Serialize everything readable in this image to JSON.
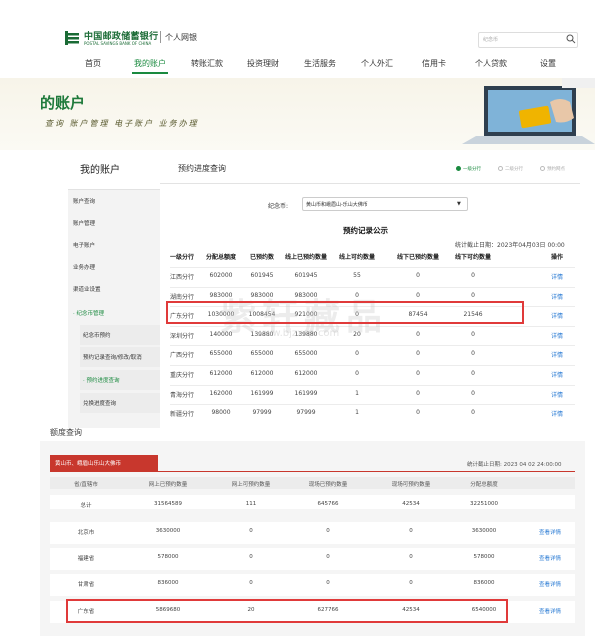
{
  "header": {
    "bank_name": "中国邮政储蓄银行",
    "bank_name_en": "POSTAL SAVINGS BANK OF CHINA",
    "site_label": "个人网银",
    "search_placeholder": "纪念币"
  },
  "nav": {
    "items": [
      "首页",
      "我的账户",
      "转账汇款",
      "投资理财",
      "生活服务",
      "个人外汇",
      "信用卡",
      "个人贷款",
      "设置"
    ],
    "active_index": 1
  },
  "banner": {
    "title": "的账户",
    "subtitle": "查询 账户管理 电子账户 业务办理"
  },
  "sidebar": {
    "title": "我的账户",
    "items": [
      "账户查询",
      "账户管理",
      "电子账户",
      "业务办理",
      "渠道业设置"
    ],
    "active_group": "· 纪念币管理",
    "sub_items": [
      "纪念币预约",
      "预约记录查询/修改/取消",
      "· 预约进度查询",
      "兑换进度查询"
    ]
  },
  "main": {
    "title": "预约进度查询",
    "steps": [
      "一级分行",
      "二级分行",
      "预约网点"
    ],
    "select_label": "纪念币:",
    "select_value": "黄山币和峨眉山-乐山大佛币",
    "publication_title": "预约记录公示",
    "stats_date": "统计截止日期：2023年04月03日 00:00",
    "table": {
      "headers": [
        "一级分行",
        "分配总额度",
        "已预约数",
        "线上已预约数量",
        "线上可约数量",
        "线下已预约数量",
        "线下可约数量",
        "操作"
      ],
      "rows": [
        [
          "江西分行",
          "602000",
          "601945",
          "601945",
          "55",
          "0",
          "0",
          "详情"
        ],
        [
          "湖南分行",
          "983000",
          "983000",
          "983000",
          "0",
          "0",
          "0",
          "详情"
        ],
        [
          "广东分行",
          "1030000",
          "1008454",
          "921000",
          "0",
          "87454",
          "21546",
          "详情"
        ],
        [
          "深圳分行",
          "140000",
          "139880",
          "139880",
          "20",
          "0",
          "0",
          "详情"
        ],
        [
          "广西分行",
          "655000",
          "655000",
          "655000",
          "0",
          "0",
          "0",
          "详情"
        ],
        [
          "重庆分行",
          "612000",
          "612000",
          "612000",
          "0",
          "0",
          "0",
          "详情"
        ],
        [
          "青海分行",
          "162000",
          "161999",
          "161999",
          "1",
          "0",
          "0",
          "详情"
        ],
        [
          "新疆分行",
          "98000",
          "97999",
          "97999",
          "1",
          "0",
          "0",
          "详情"
        ]
      ]
    },
    "watermark": "紫轩藏品",
    "watermark_url": "www.bjzxcp.com"
  },
  "quota": {
    "label": "额度查询",
    "tab": "黄山币、峨眉山乐山大佛币",
    "stats_date": "统计截止日期: 2023 04 02 24:00:00",
    "headers": [
      "省/直辖市",
      "网上已预约数量",
      "网上可预约数量",
      "现场已预约数量",
      "现场可预约数量",
      "分配总额度",
      ""
    ],
    "rows": [
      [
        "总计",
        "31564589",
        "111",
        "645766",
        "42534",
        "32251000",
        ""
      ],
      [
        "北京市",
        "3630000",
        "0",
        "0",
        "0",
        "3630000",
        "查看详情"
      ],
      [
        "福建省",
        "578000",
        "0",
        "0",
        "0",
        "578000",
        "查看详情"
      ],
      [
        "甘肃省",
        "836000",
        "0",
        "0",
        "0",
        "836000",
        "查看详情"
      ],
      [
        "广东省",
        "5869680",
        "20",
        "627766",
        "42534",
        "6540000",
        "查看详情"
      ]
    ]
  },
  "colors": {
    "brand_green": "#1a8a3f",
    "highlight_red": "#e03a3a",
    "tab_red": "#c8372d",
    "link_blue": "#2a7bd4"
  }
}
